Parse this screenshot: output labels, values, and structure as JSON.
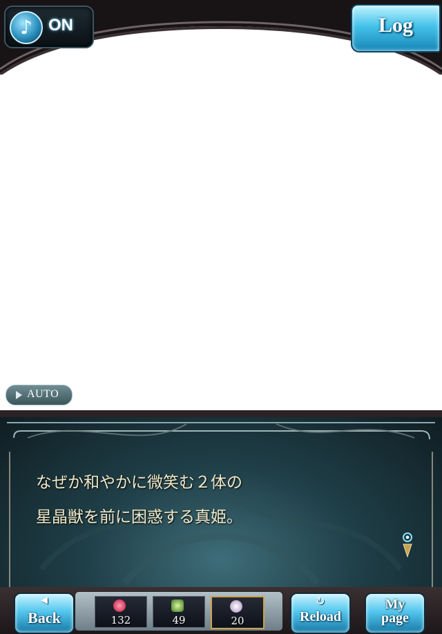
{
  "topbar": {
    "music_icon_glyph": "♪",
    "music_status": "ON",
    "log_label": "Log"
  },
  "auto_label": "AUTO",
  "dialog": {
    "lines": [
      "なぜか和やかに微笑む２体の",
      "星晶獣を前に困惑する真姫。"
    ]
  },
  "bottombar": {
    "back_glyph": "◀",
    "back_label": "Back",
    "reload_glyph": "↻",
    "reload_label": "Reload",
    "mypage_label_line1": "My",
    "mypage_label_line2": "page",
    "items": [
      {
        "icon": "red-crystal-icon",
        "count": "132"
      },
      {
        "icon": "green-potion-icon",
        "count": "49"
      },
      {
        "icon": "white-orb-icon",
        "count": "20"
      }
    ]
  },
  "colors": {
    "accent_cyan": "#46c2ea",
    "dialog_text": "#f0e9c8",
    "frame_dark": "#1d1719"
  }
}
